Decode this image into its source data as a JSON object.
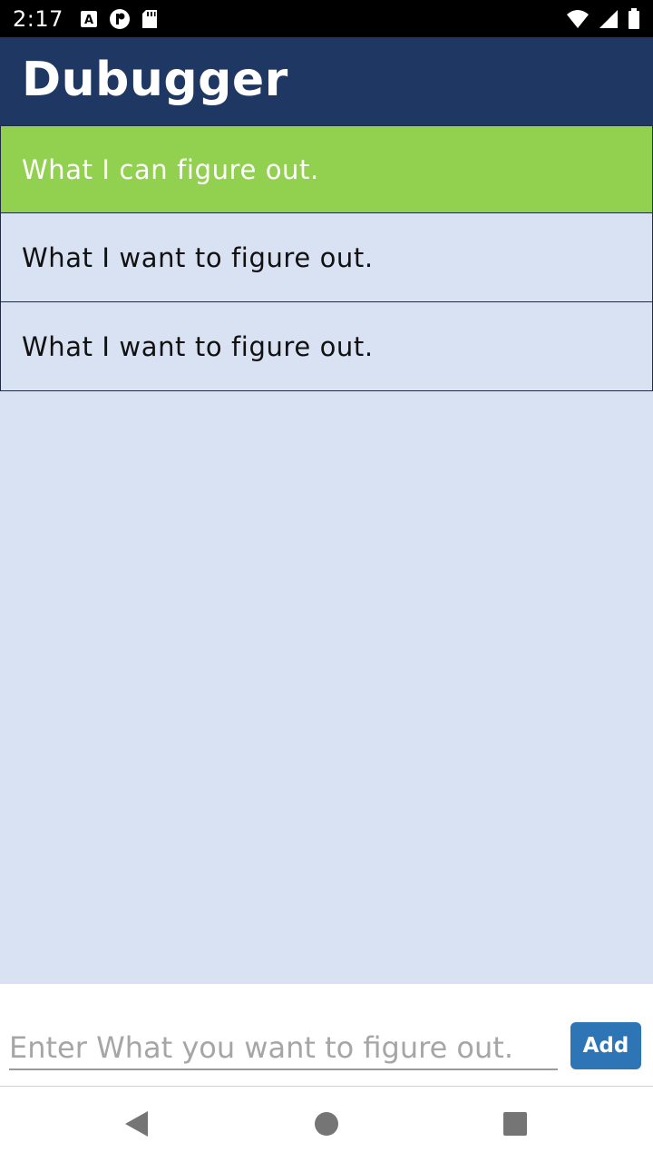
{
  "status_bar": {
    "time": "2:17",
    "left_icons": [
      "a-notification-icon",
      "sync-icon",
      "sd-card-icon"
    ],
    "right_icons": [
      "wifi-icon",
      "cell-signal-icon",
      "battery-icon"
    ]
  },
  "app_bar": {
    "title": "Dubugger"
  },
  "list": {
    "items": [
      {
        "label": "What I can figure out.",
        "state": "active",
        "color": "#92d050"
      },
      {
        "label": "What I want to figure out.",
        "state": "default"
      },
      {
        "label": "What I want to figure out.",
        "state": "default"
      }
    ]
  },
  "input": {
    "placeholder": "Enter What you want to figure out.",
    "value": ""
  },
  "add_button": {
    "label": "Add"
  },
  "nav_bar": {
    "icons": [
      "back-icon",
      "home-icon",
      "recents-icon"
    ]
  },
  "colors": {
    "app_bar": "#1f3763",
    "content_bg": "#d9e2f3",
    "active_item": "#92d050",
    "button": "#2e75b6"
  }
}
